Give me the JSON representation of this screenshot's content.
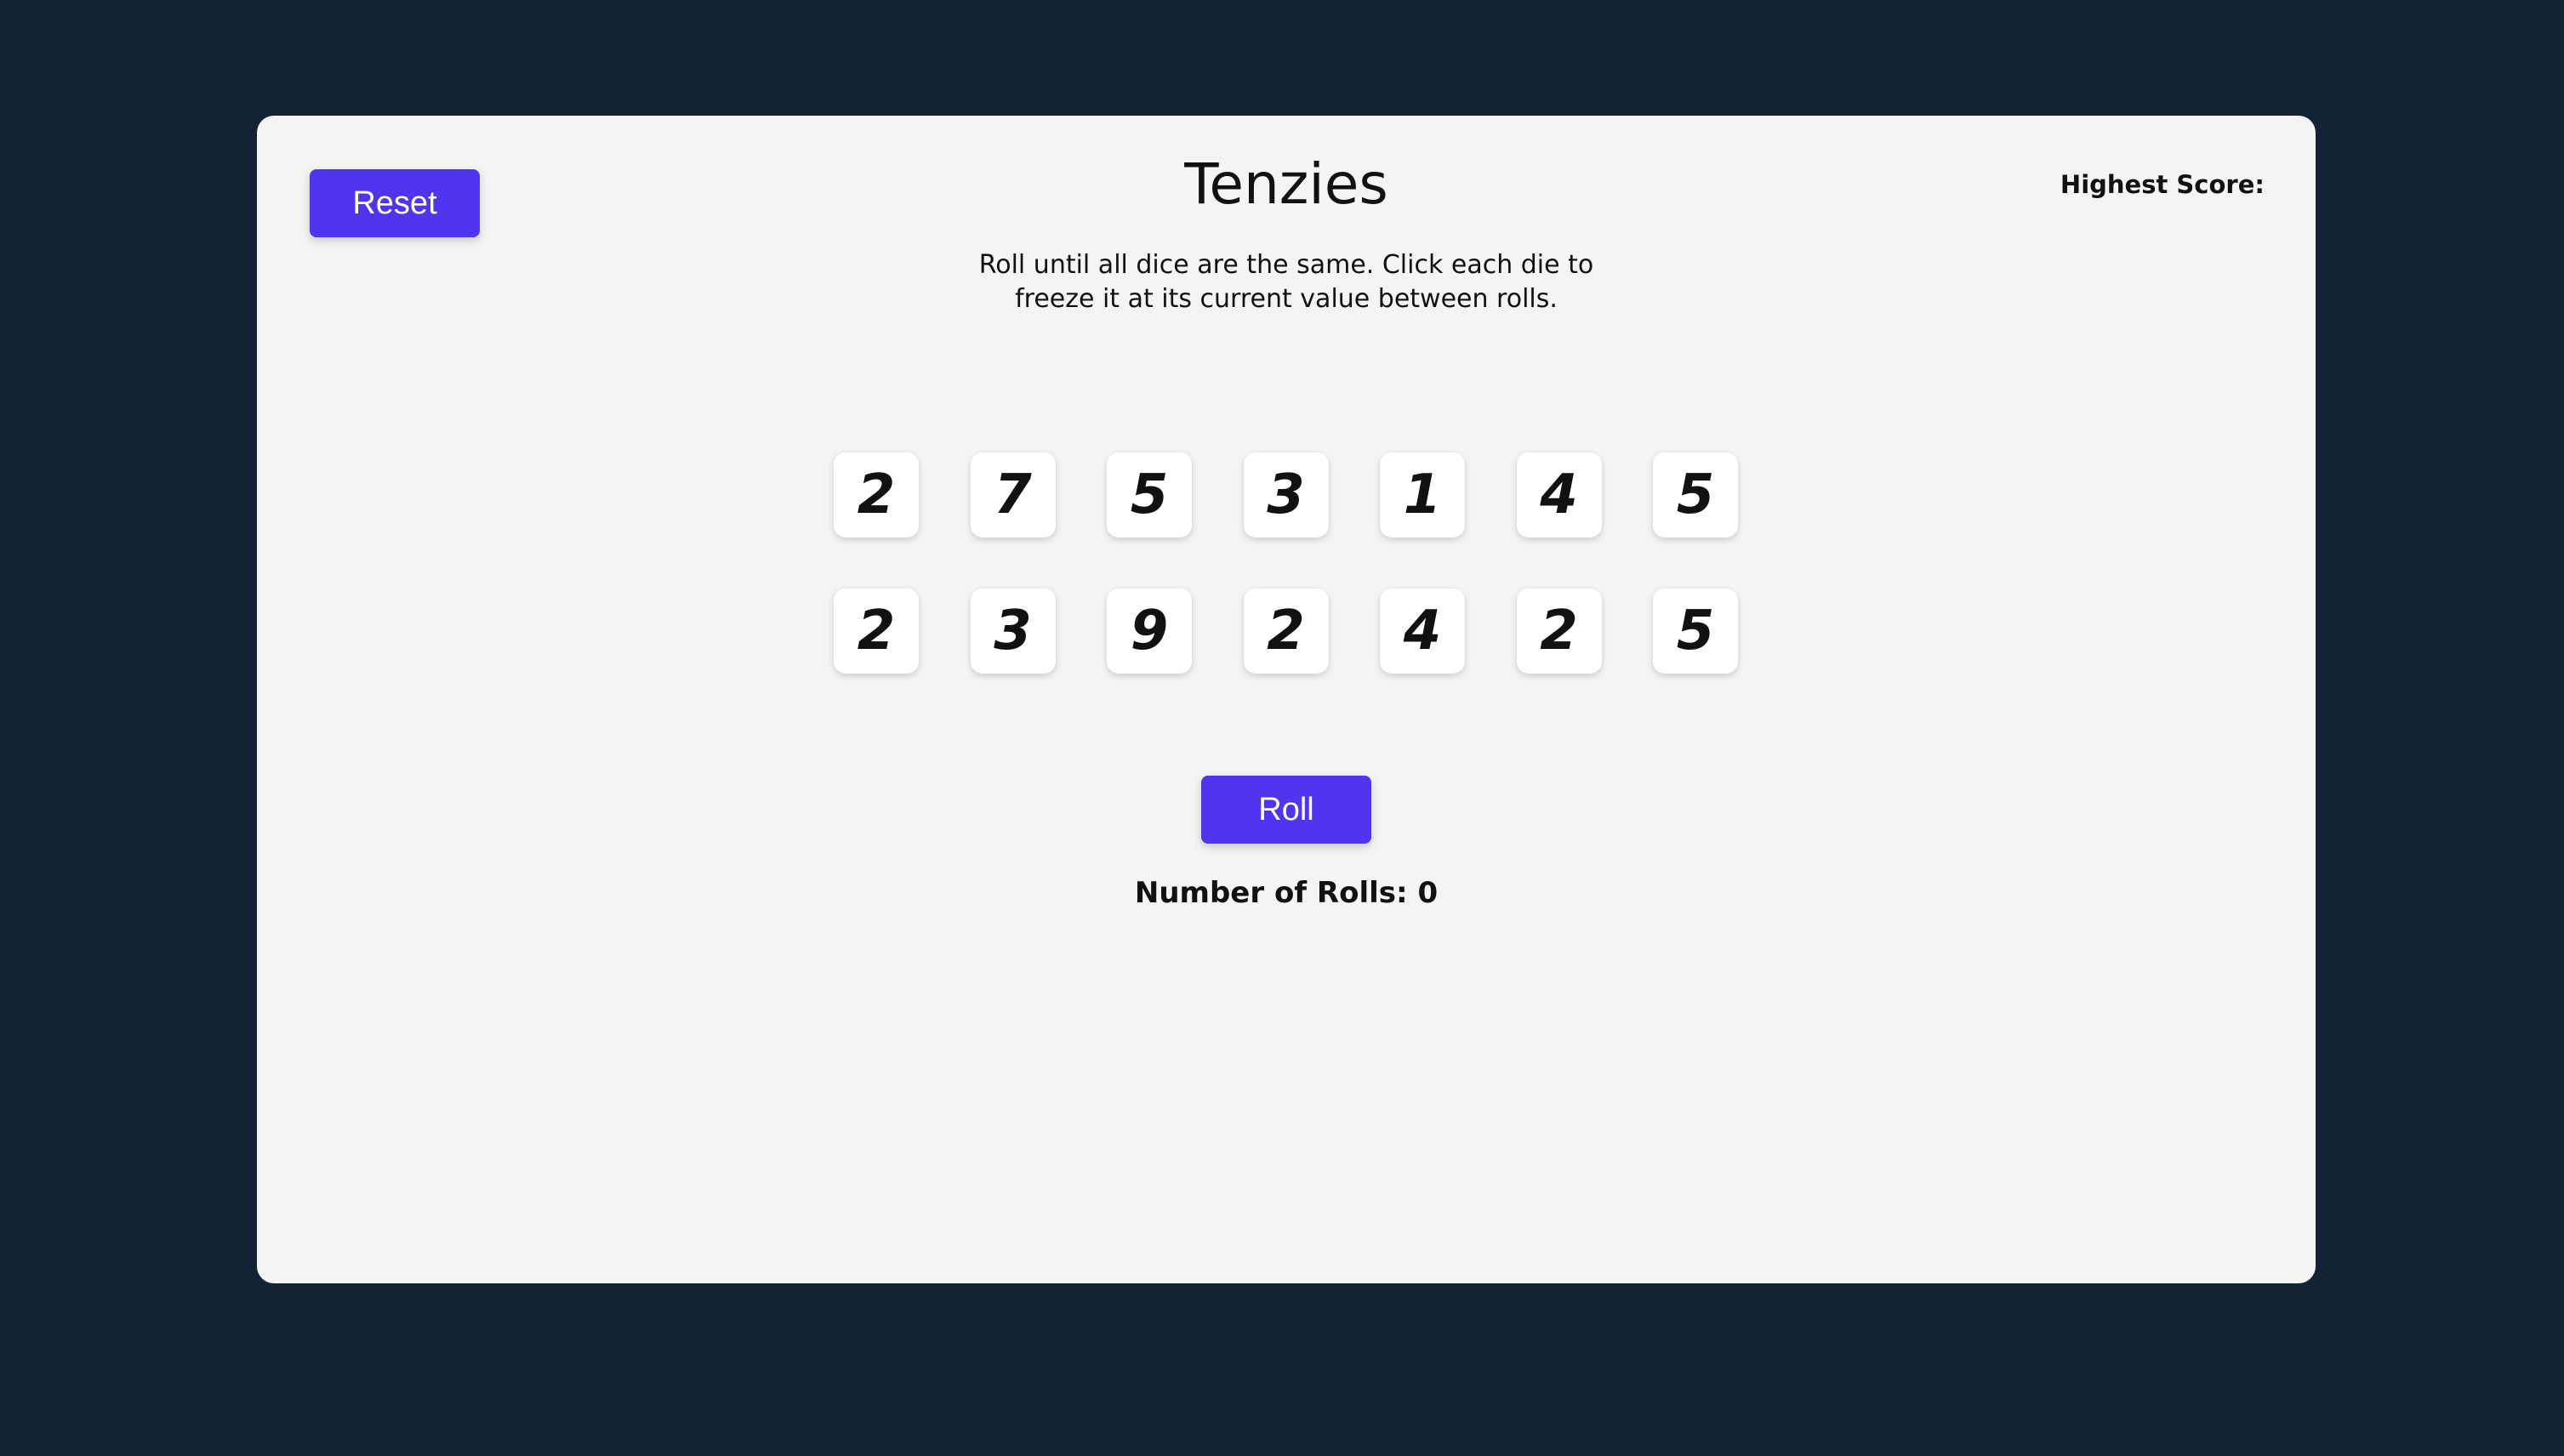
{
  "game": {
    "title": "Tenzies",
    "instructions": "Roll until all dice are the same. Click each die to freeze it at its current value between rolls.",
    "reset_label": "Reset",
    "highest_score_label": "Highest Score:",
    "roll_label": "Roll",
    "rolls_label": "Number of Rolls: 0"
  },
  "dice": [
    {
      "value": "2"
    },
    {
      "value": "7"
    },
    {
      "value": "5"
    },
    {
      "value": "3"
    },
    {
      "value": "1"
    },
    {
      "value": "4"
    },
    {
      "value": "5"
    },
    {
      "value": "2"
    },
    {
      "value": "3"
    },
    {
      "value": "9"
    },
    {
      "value": "2"
    },
    {
      "value": "4"
    },
    {
      "value": "2"
    },
    {
      "value": "5"
    }
  ],
  "colors": {
    "background": "#132234",
    "panel": "#f4f4f4",
    "accent": "#5035f0",
    "die": "#ffffff"
  }
}
